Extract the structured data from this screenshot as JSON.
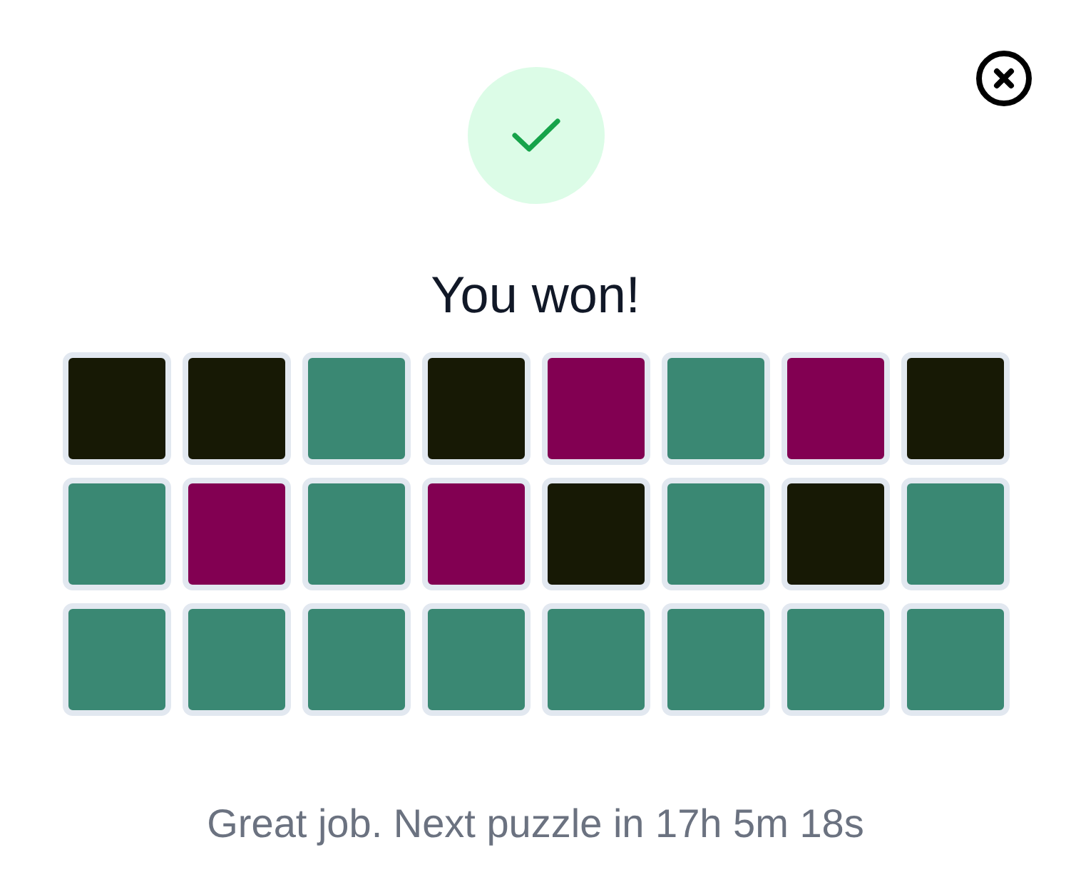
{
  "dialog": {
    "title": "You won!",
    "rows": [
      {
        "tiles": [
          {
            "color": "#171905"
          },
          {
            "color": "#171905"
          },
          {
            "color": "#3a8873"
          },
          {
            "color": "#171905"
          },
          {
            "color": "#820052"
          },
          {
            "color": "#3a8873"
          },
          {
            "color": "#820052"
          },
          {
            "color": "#171905"
          }
        ]
      },
      {
        "tiles": [
          {
            "color": "#3a8873"
          },
          {
            "color": "#820052"
          },
          {
            "color": "#3a8873"
          },
          {
            "color": "#820052"
          },
          {
            "color": "#171905"
          },
          {
            "color": "#3a8873"
          },
          {
            "color": "#171905"
          },
          {
            "color": "#3a8873"
          }
        ]
      },
      {
        "tiles": [
          {
            "color": "#3a8873"
          },
          {
            "color": "#3a8873"
          },
          {
            "color": "#3a8873"
          },
          {
            "color": "#3a8873"
          },
          {
            "color": "#3a8873"
          },
          {
            "color": "#3a8873"
          },
          {
            "color": "#3a8873"
          },
          {
            "color": "#3a8873"
          }
        ]
      }
    ],
    "message": "Great job. Next puzzle in 17h 5m 18s"
  }
}
